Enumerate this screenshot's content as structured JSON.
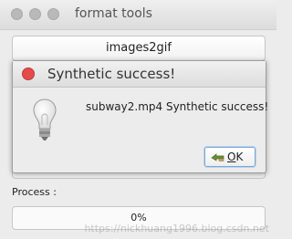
{
  "window": {
    "title": "format tools"
  },
  "buttons": {
    "images2gif": "images2gif"
  },
  "dialog": {
    "title": "Synthetic success!",
    "message": "subway2.mp4 Synthetic success!",
    "ok_mnemonic": "O",
    "ok_rest": "K"
  },
  "process": {
    "label": "Process :",
    "progress_text": "0%",
    "progress_value": 0
  },
  "watermark": "https://nickhuang1996.blog.csdn.net",
  "icons": {
    "dialog": "lightbulb-icon",
    "ok": "ok-hand-icon"
  },
  "colors": {
    "close_button": "#e44b4b",
    "ok_border": "#7fa6d1"
  }
}
